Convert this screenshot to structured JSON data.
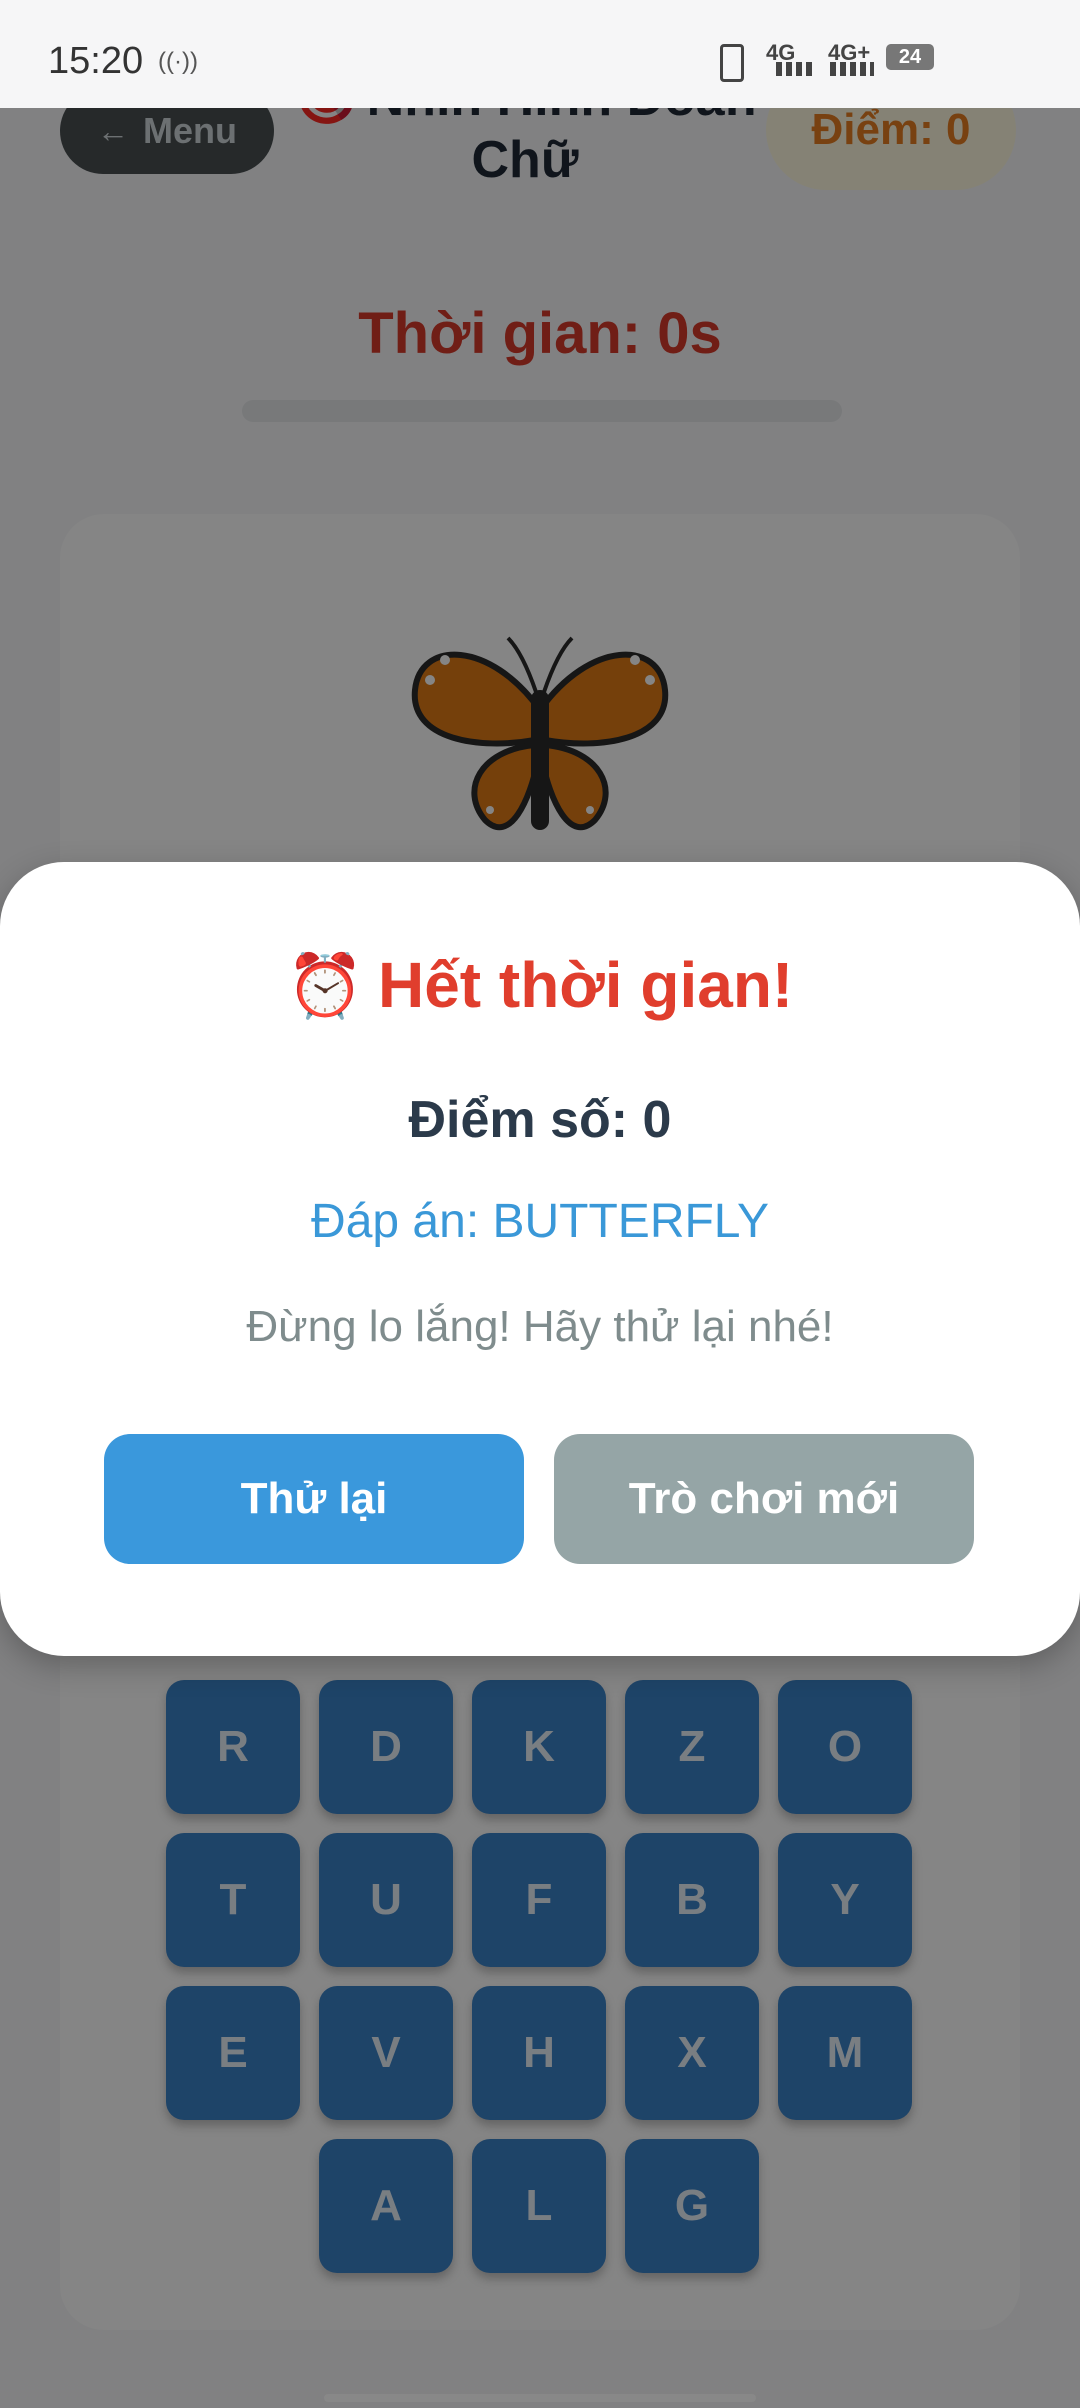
{
  "status_bar": {
    "time": "15:20",
    "network_1": "4G",
    "network_2": "4G+",
    "battery": "24"
  },
  "header": {
    "menu_label": "Menu",
    "menu_arrow": "←",
    "title": "Nhìn Hình Đoán Chữ",
    "title_icon": "🎯",
    "score": "Điểm: 0"
  },
  "game": {
    "timer": "Thời gian: 0s",
    "image_icon": "butterfly-icon",
    "keys": [
      [
        "R",
        "D",
        "K",
        "Z",
        "O"
      ],
      [
        "T",
        "U",
        "F",
        "B",
        "Y"
      ],
      [
        "E",
        "V",
        "H",
        "X",
        "M"
      ],
      [
        "A",
        "L",
        "G"
      ]
    ]
  },
  "modal": {
    "icon": "⏰",
    "title": "Hết thời gian!",
    "score": "Điểm số: 0",
    "answer": "Đáp án: BUTTERFLY",
    "message": "Đừng lo lắng! Hãy thử lại nhé!",
    "retry_label": "Thử lại",
    "new_game_label": "Trò chơi mới"
  },
  "colors": {
    "accent": "#3a98dc",
    "danger": "#e03e2d",
    "key": "#3b82c8",
    "secondary": "#95a5a6",
    "score": "#e67e22"
  }
}
